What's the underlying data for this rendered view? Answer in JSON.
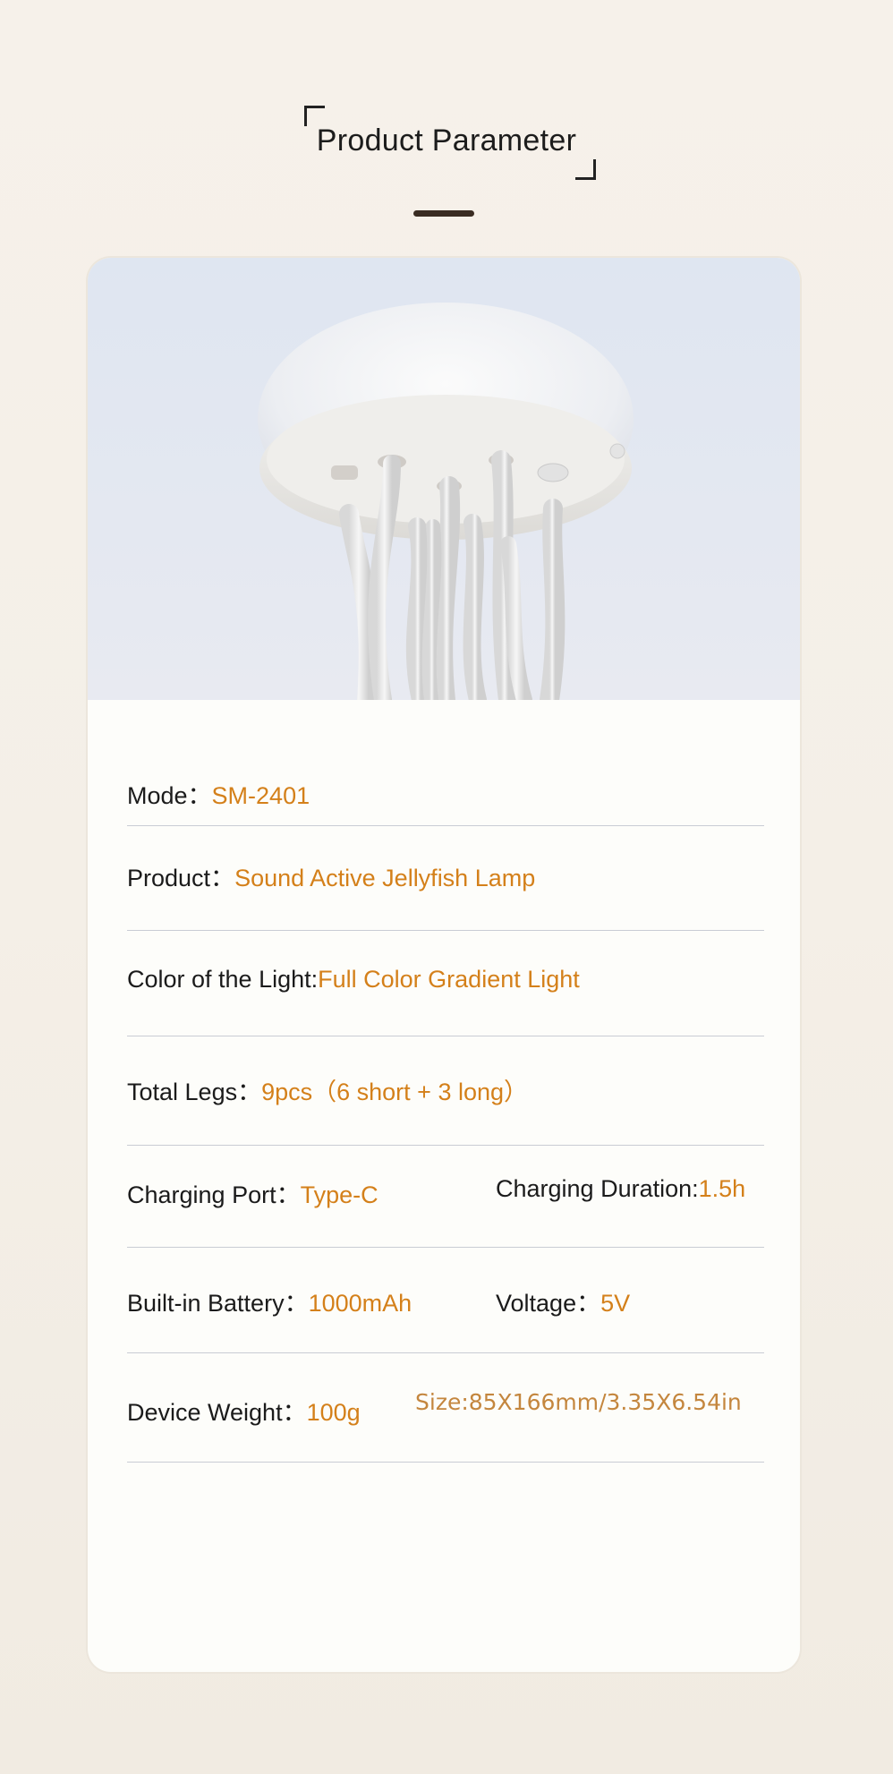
{
  "header": {
    "title": "Product Parameter"
  },
  "params": {
    "mode": {
      "label": "Mode：",
      "value": "SM-2401"
    },
    "product": {
      "label": "Product：",
      "value": "Sound Active Jellyfish Lamp"
    },
    "color": {
      "label": "Color of the Light:",
      "value": "Full Color Gradient Light"
    },
    "legs": {
      "label": "Total Legs：",
      "value": "9pcs（6 short + 3 long）"
    },
    "charging_port": {
      "label": "Charging Port：",
      "value": "Type-C"
    },
    "charging_duration": {
      "label": "Charging Duration:",
      "value": "1.5h"
    },
    "battery": {
      "label": "Built-in Battery：",
      "value": "1000mAh"
    },
    "voltage": {
      "label": "Voltage：",
      "value": "5V"
    },
    "weight": {
      "label": "Device Weight：",
      "value": "100g"
    },
    "size": {
      "value": "Size:85X166mm/3.35X6.54in"
    }
  },
  "colors": {
    "background": "#f5f0e8",
    "card": "#fdfdfa",
    "accent_value": "#d4801a",
    "label_text": "#1b1b1b",
    "divider": "#c9ccd4"
  },
  "icons": {
    "title_corner_tl": "bracket-corner-top-left",
    "title_corner_br": "bracket-corner-bottom-right"
  }
}
